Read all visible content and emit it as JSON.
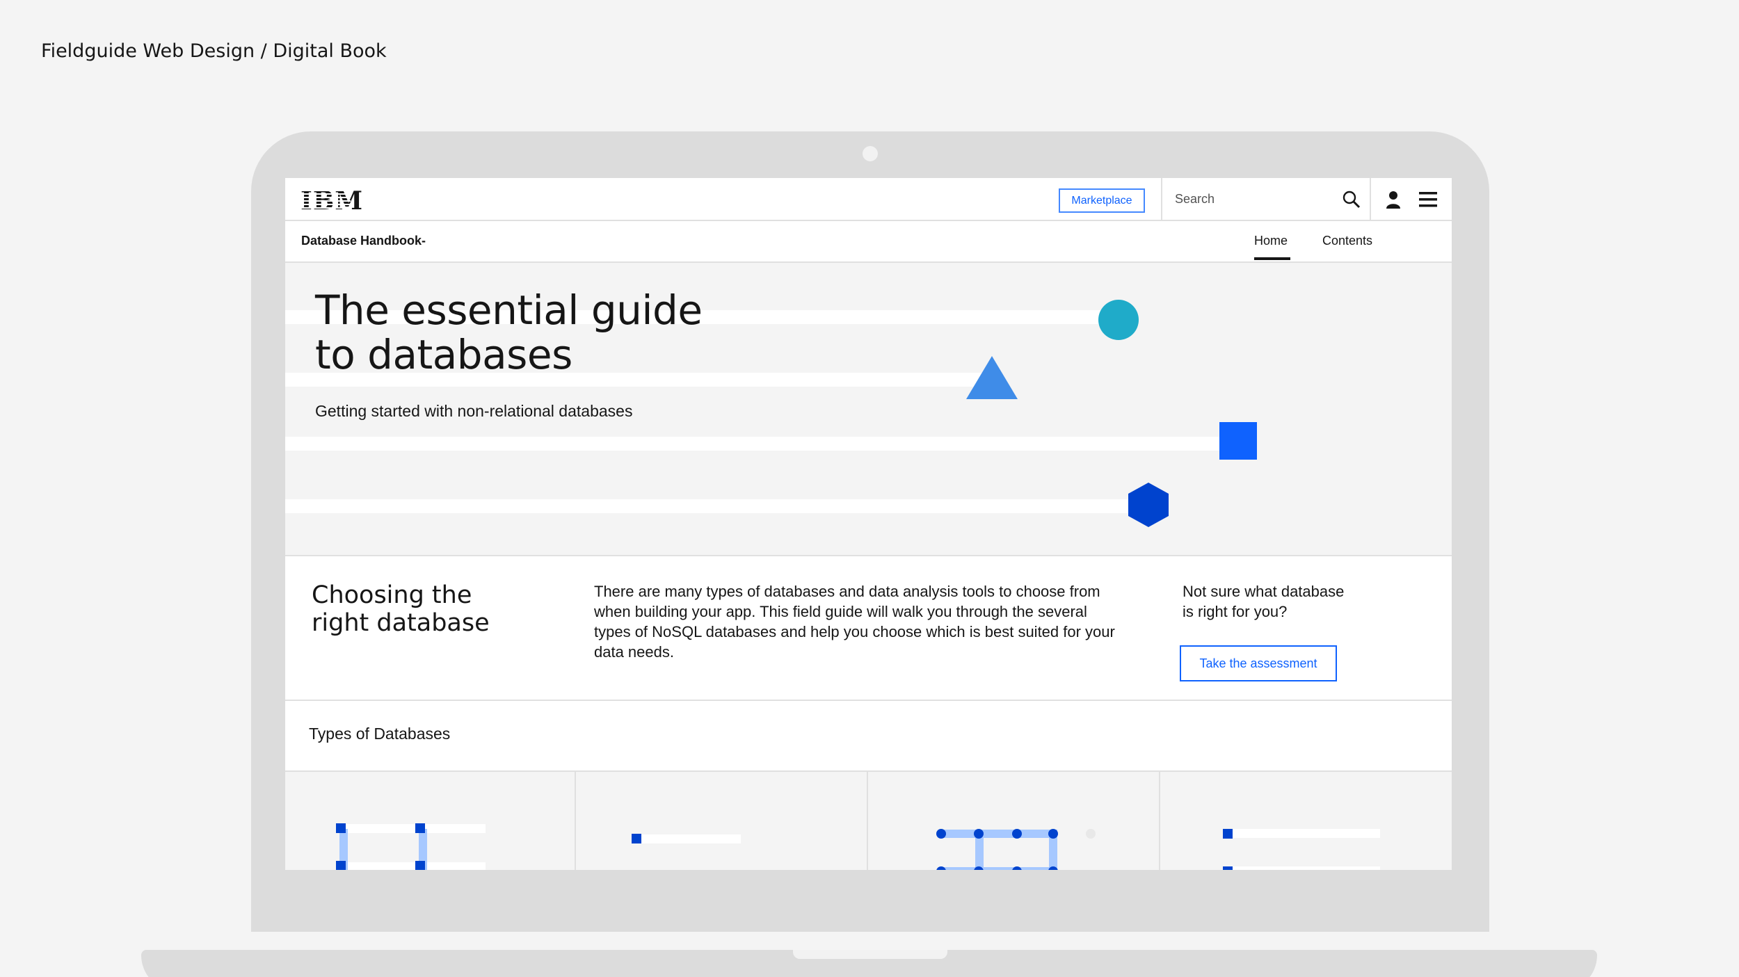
{
  "page_caption": "Fieldguide Web Design / Digital Book",
  "masthead": {
    "logo": "IBM",
    "marketplace_label": "Marketplace",
    "search_placeholder": "Search",
    "icons": [
      "search-icon",
      "user-icon",
      "menu-icon"
    ]
  },
  "subnav": {
    "title": "Database Handbook-",
    "tabs": [
      {
        "label": "Home",
        "active": true
      },
      {
        "label": "Contents",
        "active": false
      }
    ]
  },
  "hero": {
    "title_line1": "The essential guide",
    "title_line2": "to databases",
    "subtitle": "Getting started with non-relational databases",
    "shape_colors": {
      "circle": "#1fabc9",
      "triangle": "#3f8ce8",
      "square": "#0f62fe",
      "hexagon": "#0043ce"
    }
  },
  "intro": {
    "heading_line1": "Choosing the",
    "heading_line2": "right database",
    "body": "There are many types of databases and data analysis tools to choose from when building your app. This field guide will walk you through the several types of NoSQL databases and help you choose which is best suited for your data needs.",
    "question_line1": "Not sure what database",
    "question_line2": "is right for you?",
    "cta_label": "Take the assessment"
  },
  "types": {
    "title": "Types of Databases"
  },
  "colors": {
    "accent": "#0f62fe",
    "light_accent": "#a6c8ff",
    "background": "#f4f4f4"
  }
}
